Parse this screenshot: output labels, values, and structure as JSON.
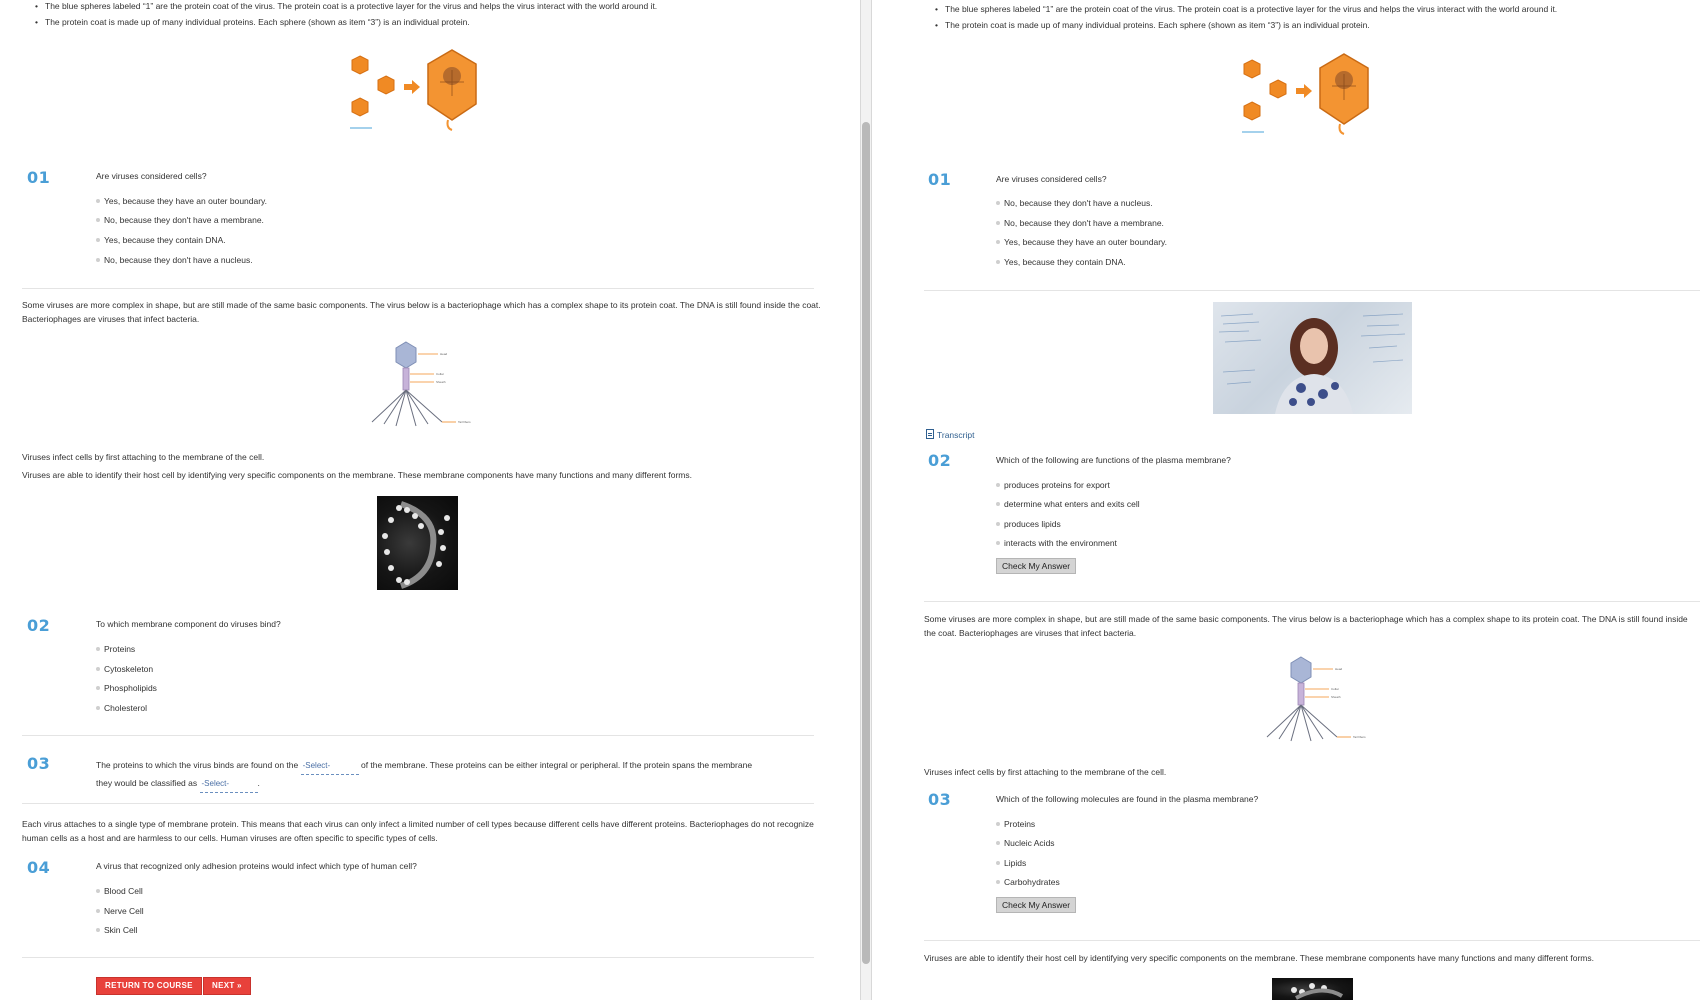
{
  "intro_bullets": [
    "The blue spheres labeled “1” are the protein coat of the virus. The protein coat is a protective layer for the virus and helps the virus interact with the world around it.",
    "The protein coat is made up of many individual proteins. Each sphere (shown as item “3”) is an individual protein."
  ],
  "paragraphs": {
    "complex": "Some viruses are more complex in shape, but are still made of the same basic components. The virus below is a bacteriophage which has a complex shape to its protein coat. The DNA is still found inside the coat. Bacteriophages are viruses that infect bacteria.",
    "infect": "Viruses infect cells by first attaching to the membrane of the cell.",
    "identify": "Viruses are able to identify their host cell by identifying very specific components on the membrane. These membrane components have many functions and many different forms.",
    "attach": "Each virus attaches to a single type of membrane protein. This means that each virus can only infect a limited number of cell types because different cells have different proteins. Bacteriophages do not recognize human cells as a host and are harmless to our cells. Human viruses are often specific to specific types of cells."
  },
  "left": {
    "q1": {
      "num": "01",
      "text": "Are viruses considered cells?",
      "options": [
        "Yes, because they have an outer boundary.",
        "No, because they don't have a membrane.",
        "Yes, because they contain DNA.",
        "No, because they don't have a nucleus."
      ]
    },
    "q2": {
      "num": "02",
      "text": "To which membrane component do viruses bind?",
      "options": [
        "Proteins",
        "Cytoskeleton",
        "Phospholipids",
        "Cholesterol"
      ]
    },
    "q3": {
      "num": "03",
      "text_a": "The proteins to which the virus binds are found on the",
      "select_a": "-Select-",
      "text_b": "of the membrane. These proteins can be either integral or peripheral. If the protein spans the membrane",
      "text_c": "they would be classified as",
      "select_b": "-Select-",
      "text_d": "."
    },
    "q4": {
      "num": "04",
      "text": "A virus that recognized only adhesion proteins would infect which type of human cell?",
      "options": [
        "Blood Cell",
        "Nerve Cell",
        "Skin Cell"
      ]
    },
    "return_btn": "RETURN TO COURSE",
    "next_btn": "NEXT »"
  },
  "right": {
    "q1": {
      "num": "01",
      "text": "Are viruses considered cells?",
      "options": [
        "No, because they don't have a nucleus.",
        "No, because they don't have a membrane.",
        "Yes, because they have an outer boundary.",
        "Yes, because they contain DNA."
      ]
    },
    "transcript": "Transcript",
    "q2": {
      "num": "02",
      "text": "Which of the following are functions of the plasma membrane?",
      "options": [
        "produces proteins for export",
        "determine what enters and exits cell",
        "produces lipids",
        "interacts with the environment"
      ]
    },
    "q3": {
      "num": "03",
      "text": "Which of the following molecules are found in the plasma membrane?",
      "options": [
        "Proteins",
        "Nucleic Acids",
        "Lipids",
        "Carbohydrates"
      ]
    },
    "check_btn": "Check My Answer"
  }
}
